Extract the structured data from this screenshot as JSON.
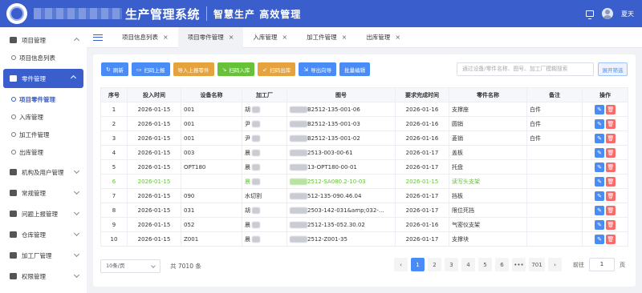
{
  "header": {
    "system_title": "生产管理系统",
    "slogan": "智慧生产 高效管理",
    "username": "夏天"
  },
  "sidebar": {
    "items": [
      {
        "label": "项目管理",
        "icon": "grid-icon"
      },
      {
        "label": "项目信息列表"
      },
      {
        "label": "零件管理",
        "icon": "parts-icon"
      },
      {
        "label": "项目零件管理"
      },
      {
        "label": "入库管理"
      },
      {
        "label": "加工件管理"
      },
      {
        "label": "出库管理"
      },
      {
        "label": "机构及用户管理",
        "icon": "org-icon"
      },
      {
        "label": "常规管理",
        "icon": "gears-icon"
      },
      {
        "label": "问题上报管理",
        "icon": "report-icon"
      },
      {
        "label": "仓库管理",
        "icon": "warehouse-icon"
      },
      {
        "label": "加工厂管理",
        "icon": "factory-icon"
      },
      {
        "label": "权限管理",
        "icon": "users-icon"
      }
    ]
  },
  "tabs": [
    {
      "label": "项目信息列表"
    },
    {
      "label": "项目零件管理"
    },
    {
      "label": "入库管理"
    },
    {
      "label": "加工件管理"
    },
    {
      "label": "出库管理"
    }
  ],
  "toolbar": {
    "refresh": "刷新",
    "scan_upload": "扫码上报",
    "import_parts": "导入上报零件",
    "scan_in": "扫码入库",
    "scan_out": "扫码出库",
    "export_guide": "导出向导",
    "batch_edit": "批量编辑",
    "search_placeholder": "通过设备/零件名称、图号、加工厂模糊搜索",
    "expand_filter": "展开筛选"
  },
  "table": {
    "headers": [
      "序号",
      "投入时间",
      "设备名称",
      "加工厂",
      "图号",
      "要求完成时间",
      "零件名称",
      "备注",
      "操作"
    ],
    "rows": [
      {
        "no": "1",
        "date": "2026-01-15",
        "device": "001",
        "factory": "胡",
        "drawing": "B2512-135-001-06",
        "due": "2026-01-16",
        "part": "支撑座",
        "note": "白件"
      },
      {
        "no": "2",
        "date": "2026-01-15",
        "device": "001",
        "factory": "尹",
        "drawing": "B2512-135-001-03",
        "due": "2026-01-16",
        "part": "圆销",
        "note": "白件"
      },
      {
        "no": "3",
        "date": "2026-01-15",
        "device": "001",
        "factory": "尹",
        "drawing": "B2512-135-001-02",
        "due": "2026-01-16",
        "part": "菱销",
        "note": "白件"
      },
      {
        "no": "4",
        "date": "2026-01-15",
        "device": "003",
        "factory": "晨",
        "drawing": "2513-003-00-61",
        "due": "2026-01-17",
        "part": "盖板",
        "note": ""
      },
      {
        "no": "5",
        "date": "2026-01-15",
        "device": "OPT180",
        "factory": "晨",
        "drawing": "13-OPT180-00-01",
        "due": "2026-01-17",
        "part": "托盘",
        "note": ""
      },
      {
        "no": "6",
        "date": "2026-01-15",
        "device": "",
        "factory": "晨",
        "drawing": "2512-SA080.2-10-03",
        "due": "2026-01-15",
        "part": "读写头支架",
        "note": ""
      },
      {
        "no": "7",
        "date": "2026-01-15",
        "device": "090",
        "factory": "水切割",
        "drawing": "512-135-090.46.04",
        "due": "2026-01-17",
        "part": "挡板",
        "note": ""
      },
      {
        "no": "8",
        "date": "2026-01-15",
        "device": "031",
        "factory": "胡",
        "drawing": "2503-142-031&amp;032-...",
        "due": "2026-01-17",
        "part": "限位死挡",
        "note": ""
      },
      {
        "no": "9",
        "date": "2026-01-15",
        "device": "052",
        "factory": "晨",
        "drawing": "2512-135-052.30.02",
        "due": "2026-01-16",
        "part": "气密仪支架",
        "note": ""
      },
      {
        "no": "10",
        "date": "2026-01-15",
        "device": "Z001",
        "factory": "晨",
        "drawing": "2512-Z001-35",
        "due": "2026-01-17",
        "part": "支撑块",
        "note": ""
      }
    ]
  },
  "pager": {
    "page_size": "10条/页",
    "total": "共 7010 条",
    "pages": [
      "1",
      "2",
      "3",
      "4",
      "5",
      "6",
      "•••",
      "701"
    ],
    "goto_label": "前往",
    "goto_value": "1",
    "page_unit": "页"
  },
  "colors": {
    "primary": "#3a5fcd",
    "button_blue": "#4a8cf7",
    "button_orange": "#e6a23c",
    "button_green": "#67c23a",
    "danger": "#f56c6c"
  }
}
